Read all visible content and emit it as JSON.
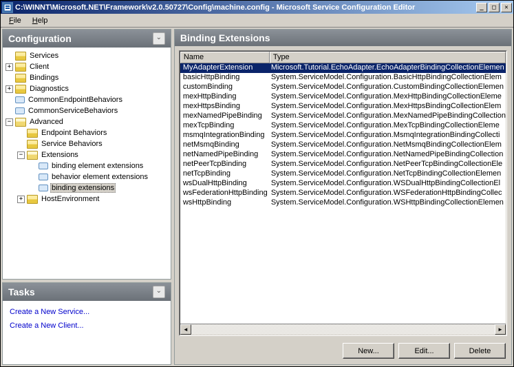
{
  "window": {
    "title": "C:\\WINNT\\Microsoft.NET\\Framework\\v2.0.50727\\Config\\machine.config - Microsoft Service Configuration Editor"
  },
  "menu": {
    "file": "File",
    "help": "Help"
  },
  "leftPanes": {
    "configTitle": "Configuration",
    "tasksTitle": "Tasks"
  },
  "tree": {
    "services": "Services",
    "client": "Client",
    "bindings": "Bindings",
    "diagnostics": "Diagnostics",
    "commonEndpointBehaviors": "CommonEndpointBehaviors",
    "commonServiceBehaviors": "CommonServiceBehaviors",
    "advanced": "Advanced",
    "endpointBehaviors": "Endpoint Behaviors",
    "serviceBehaviors": "Service Behaviors",
    "extensions": "Extensions",
    "bindingElementExt": "binding element extensions",
    "behaviorElementExt": "behavior element extensions",
    "bindingExt": "binding extensions",
    "hostEnvironment": "HostEnvironment"
  },
  "tasks": {
    "createService": "Create a New Service...",
    "createClient": "Create a New Client..."
  },
  "rightPane": {
    "title": "Binding Extensions",
    "columns": {
      "name": "Name",
      "type": "Type"
    },
    "rows": [
      {
        "name": "MyAdapterExtension",
        "type": "Microsoft.Tutorial.EchoAdapter.EchoAdapterBindingCollectionElemen",
        "selected": true
      },
      {
        "name": "basicHttpBinding",
        "type": "System.ServiceModel.Configuration.BasicHttpBindingCollectionElem"
      },
      {
        "name": "customBinding",
        "type": "System.ServiceModel.Configuration.CustomBindingCollectionElemen"
      },
      {
        "name": "mexHttpBinding",
        "type": "System.ServiceModel.Configuration.MexHttpBindingCollectionEleme"
      },
      {
        "name": "mexHttpsBinding",
        "type": "System.ServiceModel.Configuration.MexHttpsBindingCollectionElem"
      },
      {
        "name": "mexNamedPipeBinding",
        "type": "System.ServiceModel.Configuration.MexNamedPipeBindingCollection"
      },
      {
        "name": "mexTcpBinding",
        "type": "System.ServiceModel.Configuration.MexTcpBindingCollectionEleme"
      },
      {
        "name": "msmqIntegrationBinding",
        "type": "System.ServiceModel.Configuration.MsmqIntegrationBindingCollecti"
      },
      {
        "name": "netMsmqBinding",
        "type": "System.ServiceModel.Configuration.NetMsmqBindingCollectionElem"
      },
      {
        "name": "netNamedPipeBinding",
        "type": "System.ServiceModel.Configuration.NetNamedPipeBindingCollection"
      },
      {
        "name": "netPeerTcpBinding",
        "type": "System.ServiceModel.Configuration.NetPeerTcpBindingCollectionEle"
      },
      {
        "name": "netTcpBinding",
        "type": "System.ServiceModel.Configuration.NetTcpBindingCollectionElemen"
      },
      {
        "name": "wsDualHttpBinding",
        "type": "System.ServiceModel.Configuration.WSDualHttpBindingCollectionEl"
      },
      {
        "name": "wsFederationHttpBinding",
        "type": "System.ServiceModel.Configuration.WSFederationHttpBindingCollec"
      },
      {
        "name": "wsHttpBinding",
        "type": "System.ServiceModel.Configuration.WSHttpBindingCollectionElemen"
      }
    ],
    "buttons": {
      "new": "New...",
      "edit": "Edit...",
      "delete": "Delete"
    }
  }
}
